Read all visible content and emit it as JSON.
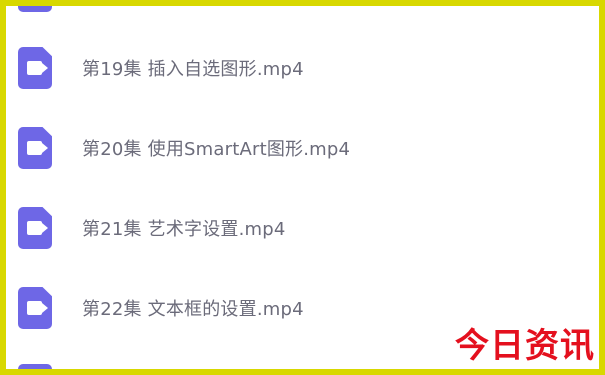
{
  "files": [
    {
      "name": "第19集 插入自选图形.mp4",
      "icon": "video-file-icon"
    },
    {
      "name": "第20集 使用SmartArt图形.mp4",
      "icon": "video-file-icon"
    },
    {
      "name": "第21集 艺术字设置.mp4",
      "icon": "video-file-icon"
    },
    {
      "name": "第22集 文本框的设置.mp4",
      "icon": "video-file-icon"
    }
  ],
  "watermark": "今日资讯",
  "colors": {
    "frame": "#d8d800",
    "icon": "#6e67e6",
    "text": "#6b6b7a",
    "watermark": "#e4101e"
  }
}
